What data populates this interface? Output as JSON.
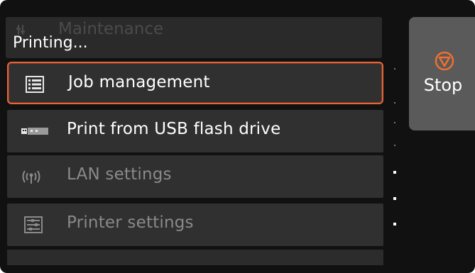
{
  "header": {
    "ghost_title": "Maintenance",
    "status": "Printing..."
  },
  "menu": {
    "items": [
      {
        "label": "Job management",
        "icon": "job-list-icon",
        "state": "selected"
      },
      {
        "label": "Print from USB flash drive",
        "icon": "usb-drive-icon",
        "state": "enabled"
      },
      {
        "label": "LAN settings",
        "icon": "wireless-antenna-icon",
        "state": "disabled"
      },
      {
        "label": "Printer settings",
        "icon": "printer-settings-icon",
        "state": "disabled"
      }
    ]
  },
  "stop": {
    "label": "Stop",
    "icon": "stop-icon"
  },
  "colors": {
    "background": "#111111",
    "item": "#303030",
    "selection_border": "#e4643c",
    "stop_button": "#5a5a5a",
    "stop_icon": "#f07030"
  }
}
